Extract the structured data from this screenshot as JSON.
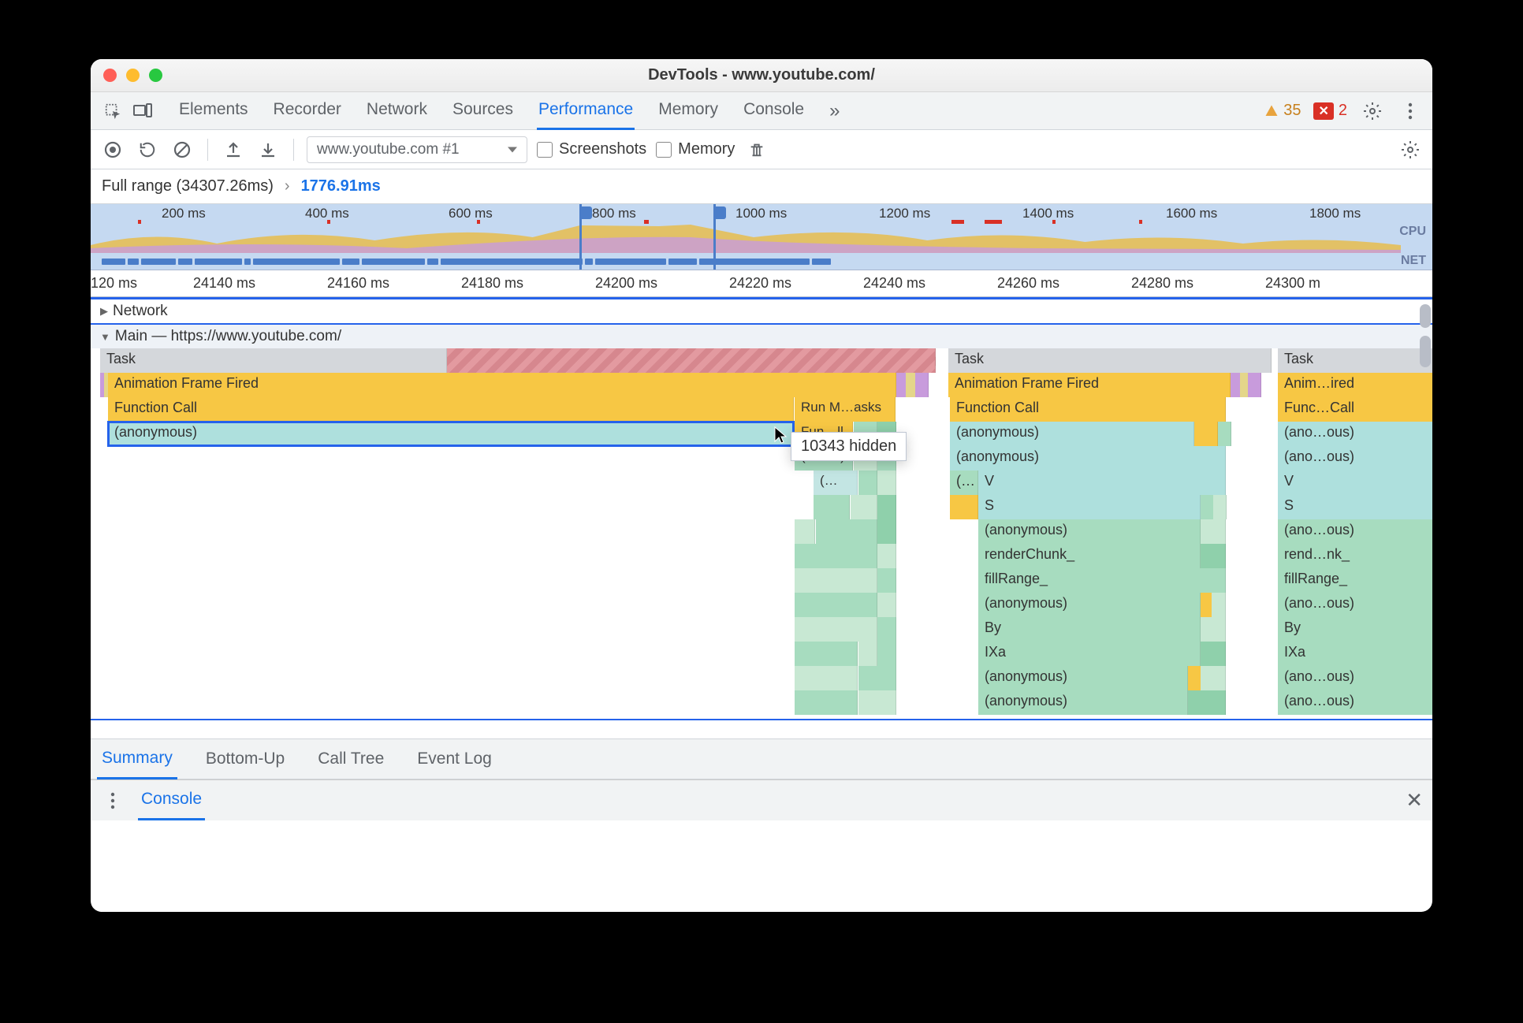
{
  "window": {
    "title": "DevTools - www.youtube.com/"
  },
  "tabbar": {
    "tabs": [
      "Elements",
      "Recorder",
      "Network",
      "Sources",
      "Performance",
      "Memory",
      "Console"
    ],
    "more": "»",
    "active": "Performance",
    "warn_count": "35",
    "err_count": "2"
  },
  "toolbar": {
    "profile_select": "www.youtube.com #1",
    "chk_screenshots": "Screenshots",
    "chk_memory": "Memory"
  },
  "breadcrumb": {
    "full": "Full range (34307.26ms)",
    "sep": "›",
    "selected": "1776.91ms"
  },
  "overview": {
    "ticks": [
      "200 ms",
      "400 ms",
      "600 ms",
      "800 ms",
      "1000 ms",
      "1200 ms",
      "1400 ms",
      "1600 ms",
      "1800 ms"
    ],
    "labels": {
      "cpu": "CPU",
      "net": "NET"
    }
  },
  "ruler2": [
    "120 ms",
    "24140 ms",
    "24160 ms",
    "24180 ms",
    "24200 ms",
    "24220 ms",
    "24240 ms",
    "24260 ms",
    "24280 ms",
    "24300 m"
  ],
  "tracks": {
    "network": "Network",
    "main": "Main — https://www.youtube.com/"
  },
  "flame": {
    "task": "Task",
    "aff": "Animation Frame Fired",
    "fcall": "Function Call",
    "anon": "(anonymous)",
    "run_m": "Run M…asks",
    "fun_ll": "Fun…ll",
    "an_s": "(an…s)",
    "paren": "(…",
    "v": "V",
    "s": "S",
    "renderChunk": "renderChunk_",
    "fillRange": "fillRange_",
    "by": "By",
    "ixa": "IXa",
    "anim_ired": "Anim…ired",
    "func_call_s": "Func…Call",
    "ano_ous": "(ano…ous)",
    "rend_nk": "rend…nk_",
    "fillRange_s": "fillRange_"
  },
  "tooltip": {
    "text": "10343 hidden"
  },
  "bottom_tabs": [
    "Summary",
    "Bottom-Up",
    "Call Tree",
    "Event Log"
  ],
  "drawer": {
    "tab": "Console"
  }
}
